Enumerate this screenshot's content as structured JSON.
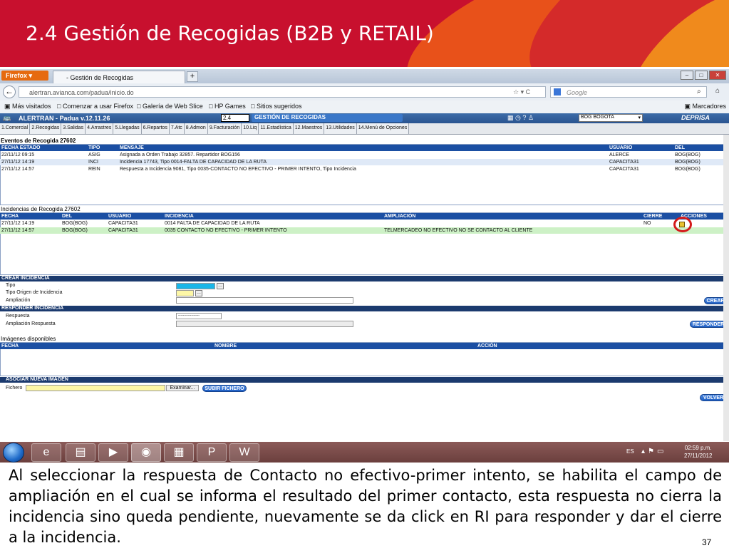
{
  "slide": {
    "title": "2.4 Gestión de Recogidas (B2B y RETAIL)",
    "caption": "Al seleccionar la respuesta de Contacto no efectivo-primer intento, se habilita el campo de ampliación en el cual se informa el resultado del primer contacto, esta respuesta no cierra la incidencia sino queda pendiente, nuevamente se da click en RI para responder y dar el cierre a la incidencia.",
    "page_number": "37"
  },
  "browser": {
    "firefox_button": "Firefox",
    "tab_title": "- Gestión de Recogidas",
    "tab_add": "+",
    "url": "alertran.avianca.com/padua/inicio.do",
    "search_placeholder": "Google",
    "bookmarks": [
      "Más visitados",
      "Comenzar a usar Firefox",
      "Galería de Web Slice",
      "HP Games",
      "Sitios sugeridos"
    ],
    "bookmarks_menu": "Marcadores"
  },
  "app": {
    "title": "ALERTRAN - Padua  v.12.11.26",
    "code": "2.4",
    "screen_name": "GESTIÓN DE RECOGIDAS",
    "city": "BOG BOGOTA",
    "brand": "DEPRISA",
    "menu": [
      "1.Comercial",
      "2.Recogidas",
      "3.Salidas",
      "4.Arrastres",
      "5.Llegadas",
      "6.Repartos",
      "7.Atc",
      "8.Admon",
      "9.Facturación",
      "10.Liq",
      "11.Estadística",
      "12.Maestros",
      "13.Utilidades",
      "14.Menú de Opciones"
    ]
  },
  "events": {
    "title": "Eventos de Recogida 27602",
    "headers": [
      "FECHA ESTADO",
      "TIPO",
      "MENSAJE",
      "USUARIO",
      "DEL"
    ],
    "rows": [
      [
        "22/11/12 09:15",
        "ASIG",
        "Asignada a Orden Trabajo 32857. Repartidor BOG156",
        "ALERCE",
        "BOG(BOG)"
      ],
      [
        "27/11/12 14:19",
        "INCI",
        "Incidencia 17743, Tipo 0014-FALTA DE CAPACIDAD DE LA RUTA",
        "CAPACITA31",
        "BOG(BOG)"
      ],
      [
        "27/11/12 14:57",
        "REIN",
        "Respuesta a Incidencia 9081, Tipo 0035-CONTACTO NO EFECTIVO - PRIMER INTENTO, Tipo Incidencia",
        "CAPACITA31",
        "BOG(BOG)"
      ]
    ]
  },
  "incidents": {
    "title": "Incidencias de Recogida 27602",
    "headers": [
      "FECHA",
      "DEL",
      "USUARIO",
      "INCIDENCIA",
      "AMPLIACIÓN",
      "CIERRE",
      "ACCIONES"
    ],
    "rows": [
      [
        "27/11/12 14:19",
        "BOG(BOG)",
        "CAPACITA31",
        "0014 FALTA DE CAPACIDAD DE LA RUTA",
        "",
        "NO"
      ],
      [
        "27/11/12 14:57",
        "BOG(BOG)",
        "CAPACITA31",
        "0035 CONTACTO NO EFECTIVO - PRIMER INTENTO",
        "TELMERCADEO NO EFECTIVO NO SE CONTACTO AL CLIENTE",
        ""
      ]
    ]
  },
  "create": {
    "header": "CREAR INCIDENCIA",
    "label_tipo": "Tipo",
    "label_origen": "Tipo Origen de Incidencia",
    "label_ampliacion": "Ampliación",
    "button": "CREAR"
  },
  "respond": {
    "header": "RESPONDER INCIDENCIA",
    "label_respuesta": "Respuesta",
    "label_ampliacion": "Ampliación Respuesta",
    "select_value": "------------------",
    "button": "RESPONDER"
  },
  "images": {
    "title": "Imágenes disponibles",
    "headers": [
      "FECHA",
      "NOMBRE",
      "ACCIÓN"
    ],
    "assoc_header": "ASOCIAR NUEVA IMAGEN",
    "label_file": "Fichero",
    "browse": "Examinar...",
    "upload": "SUBIR FICHERO",
    "back": "VOLVER"
  },
  "taskbar": {
    "lang": "ES",
    "time": "02:59 p.m.",
    "date": "27/11/2012"
  }
}
